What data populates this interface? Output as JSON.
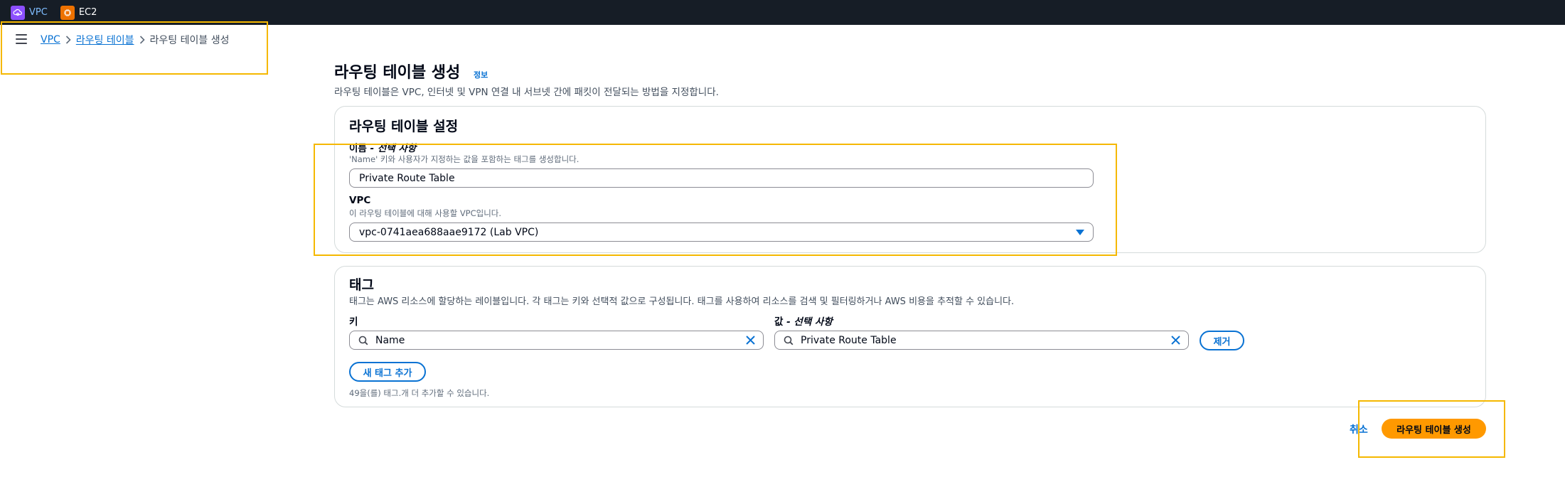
{
  "topbar": {
    "services": [
      {
        "label": "VPC",
        "icon": "vpc-icon",
        "color": "#8c4fff"
      },
      {
        "label": "EC2",
        "icon": "ec2-icon",
        "color": "#ed7100"
      }
    ]
  },
  "breadcrumb": {
    "items": [
      "VPC",
      "라우팅 테이블",
      "라우팅 테이블 생성"
    ]
  },
  "page": {
    "title": "라우팅 테이블 생성",
    "info_link": "정보",
    "description": "라우팅 테이블은 VPC, 인터넷 및 VPN 연결 내 서브넷 간에 패킷이 전달되는 방법을 지정합니다."
  },
  "settings": {
    "title": "라우팅 테이블 설정",
    "name_label": "이름",
    "name_optional": " - 선택 사항",
    "name_hint": "'Name' 키와 사용자가 지정하는 값을 포함하는 태그를 생성합니다.",
    "name_value": "Private Route Table",
    "vpc_label": "VPC",
    "vpc_hint": "이 라우팅 테이블에 대해 사용할 VPC입니다.",
    "vpc_value": "vpc-0741aea688aae9172 (Lab VPC)"
  },
  "tags": {
    "title": "태그",
    "description": "태그는 AWS 리소스에 할당하는 레이블입니다. 각 태그는 키와 선택적 값으로 구성됩니다. 태그를 사용하여 리소스를 검색 및 필터링하거나 AWS 비용을 추적할 수 있습니다.",
    "key_label": "키",
    "value_label": "값",
    "value_optional": " - 선택 사항",
    "key_value": "Name",
    "value_value": "Private Route Table",
    "remove_label": "제거",
    "add_label": "새 태그 추가",
    "remaining_hint": "49을(를) 태그.개 더 추가할 수 있습니다."
  },
  "footer": {
    "cancel_label": "취소",
    "create_label": "라우팅 테이블 생성"
  },
  "colors": {
    "accent": "#0972d3",
    "primary_button": "#ff9900",
    "highlight": "#f5b800",
    "topbar": "#161d26"
  }
}
